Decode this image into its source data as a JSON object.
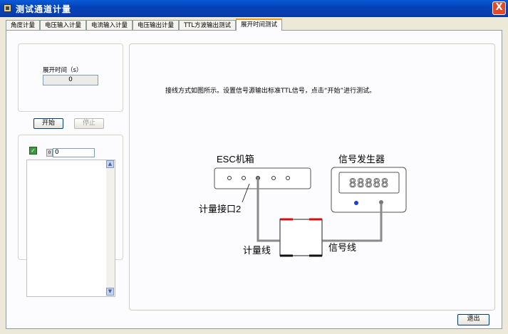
{
  "window": {
    "title": "测试通道计量",
    "close_label": "X"
  },
  "tabs": [
    {
      "label": "角度计量"
    },
    {
      "label": "电压输入计量"
    },
    {
      "label": "电流输入计量"
    },
    {
      "label": "电压输出计量"
    },
    {
      "label": "TTL方波输出测试"
    },
    {
      "label": "展开时间测试",
      "active": true
    }
  ],
  "expand_time": {
    "label": "展开时间（s）",
    "value": "0"
  },
  "buttons": {
    "start": "开始",
    "stop": "停止",
    "exit": "退出"
  },
  "log": {
    "index": "0",
    "value": "0"
  },
  "instruction": "接线方式如图所示。设置信号源输出标准TTL信号，点击“开始”进行测试。",
  "diagram": {
    "esc_box": "ESC机箱",
    "signal_gen": "信号发生器",
    "display": "88888",
    "port": "计量接口2",
    "meter_line": "计量线",
    "signal_line": "信号线"
  }
}
